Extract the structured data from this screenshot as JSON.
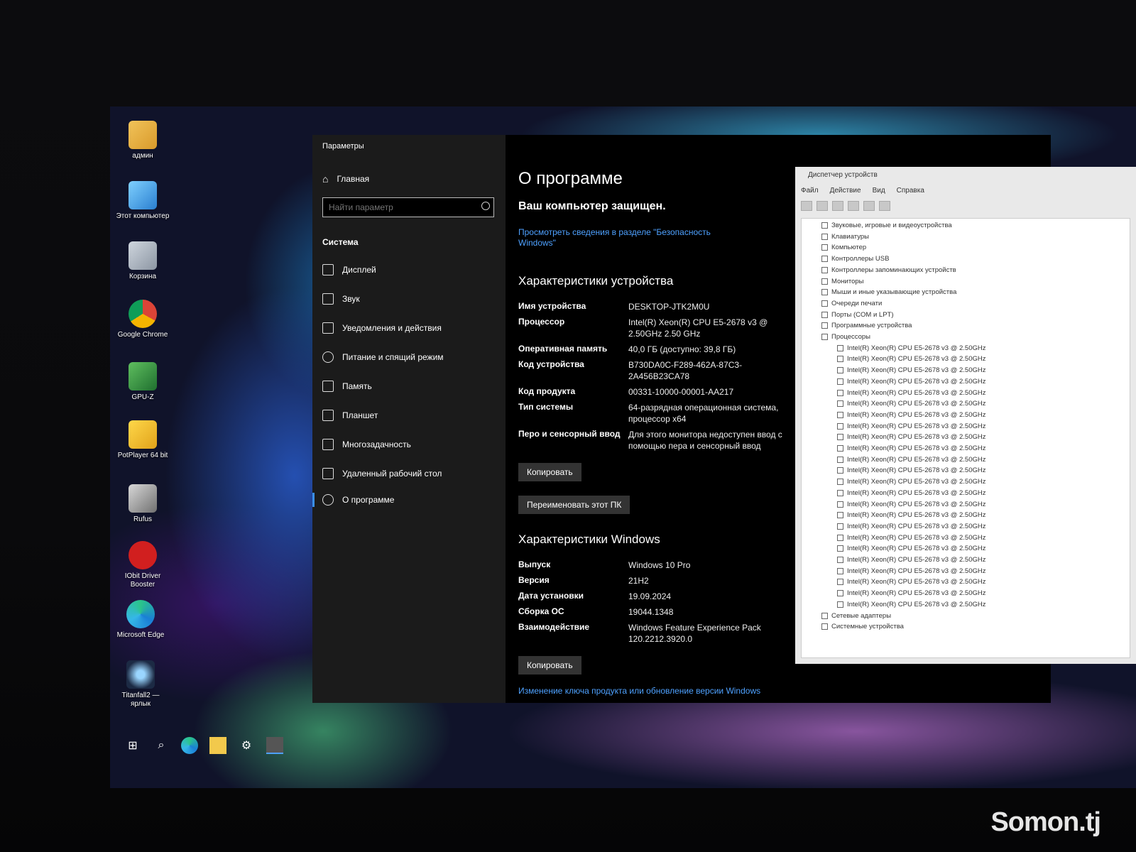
{
  "desktop": {
    "icons": [
      {
        "label": "админ"
      },
      {
        "label": "Этот компьютер"
      },
      {
        "label": "Корзина"
      },
      {
        "label": "Google Chrome"
      },
      {
        "label": "GPU-Z"
      },
      {
        "label": "PotPlayer 64 bit"
      },
      {
        "label": "Rufus"
      },
      {
        "label": "IObit Driver Booster"
      },
      {
        "label": "Microsoft Edge"
      },
      {
        "label": "Titanfall2 — ярлык"
      }
    ]
  },
  "settings": {
    "window_title": "Параметры",
    "home": "Главная",
    "search_placeholder": "Найти параметр",
    "section": "Система",
    "nav": [
      {
        "label": "Дисплей"
      },
      {
        "label": "Звук"
      },
      {
        "label": "Уведомления и действия"
      },
      {
        "label": "Питание и спящий режим"
      },
      {
        "label": "Память"
      },
      {
        "label": "Планшет"
      },
      {
        "label": "Многозадачность"
      },
      {
        "label": "Удаленный рабочий стол"
      },
      {
        "label": "О программе"
      }
    ],
    "page_title": "О программе",
    "protected": "Ваш компьютер защищен.",
    "security_link": "Просмотреть сведения в разделе \"Безопасность Windows\"",
    "device_heading": "Характеристики устройства",
    "device_specs": [
      {
        "label": "Имя устройства",
        "value": "DESKTOP-JTK2M0U"
      },
      {
        "label": "Процессор",
        "value": "Intel(R) Xeon(R) CPU E5-2678 v3 @ 2.50GHz 2.50 GHz"
      },
      {
        "label": "Оперативная память",
        "value": "40,0 ГБ (доступно: 39,8 ГБ)"
      },
      {
        "label": "Код устройства",
        "value": "B730DA0C-F289-462A-87C3-2A456B23CA78"
      },
      {
        "label": "Код продукта",
        "value": "00331-10000-00001-AA217"
      },
      {
        "label": "Тип системы",
        "value": "64-разрядная операционная система, процессор x64"
      },
      {
        "label": "Перо и сенсорный ввод",
        "value": "Для этого монитора недоступен ввод с помощью пера и сенсорный ввод"
      }
    ],
    "copy_button": "Копировать",
    "rename_button": "Переименовать этот ПК",
    "windows_heading": "Характеристики Windows",
    "windows_specs": [
      {
        "label": "Выпуск",
        "value": "Windows 10 Pro"
      },
      {
        "label": "Версия",
        "value": "21H2"
      },
      {
        "label": "Дата установки",
        "value": "19.09.2024"
      },
      {
        "label": "Сборка ОС",
        "value": "19044.1348"
      },
      {
        "label": "Взаимодействие",
        "value": "Windows Feature Experience Pack 120.2212.3920.0"
      }
    ],
    "copy_button_2": "Копировать",
    "product_key_link": "Изменение ключа продукта или обновление версии Windows"
  },
  "device_manager": {
    "title": "Диспетчер устройств",
    "menu": [
      "Файл",
      "Действие",
      "Вид",
      "Справка"
    ],
    "categories": [
      "Звуковые, игровые и видеоустройства",
      "Клавиатуры",
      "Компьютер",
      "Контроллеры USB",
      "Контроллеры запоминающих устройств",
      "Мониторы",
      "Мыши и иные указывающие устройства",
      "Очереди печати",
      "Порты (COM и LPT)",
      "Программные устройства",
      "Процессоры"
    ],
    "cpu_entry": "Intel(R) Xeon(R) CPU E5-2678 v3 @ 2.50GHz",
    "cpu_count": 24,
    "after": [
      "Сетевые адаптеры",
      "Системные устройства"
    ]
  },
  "watermark": "Somon.tj"
}
